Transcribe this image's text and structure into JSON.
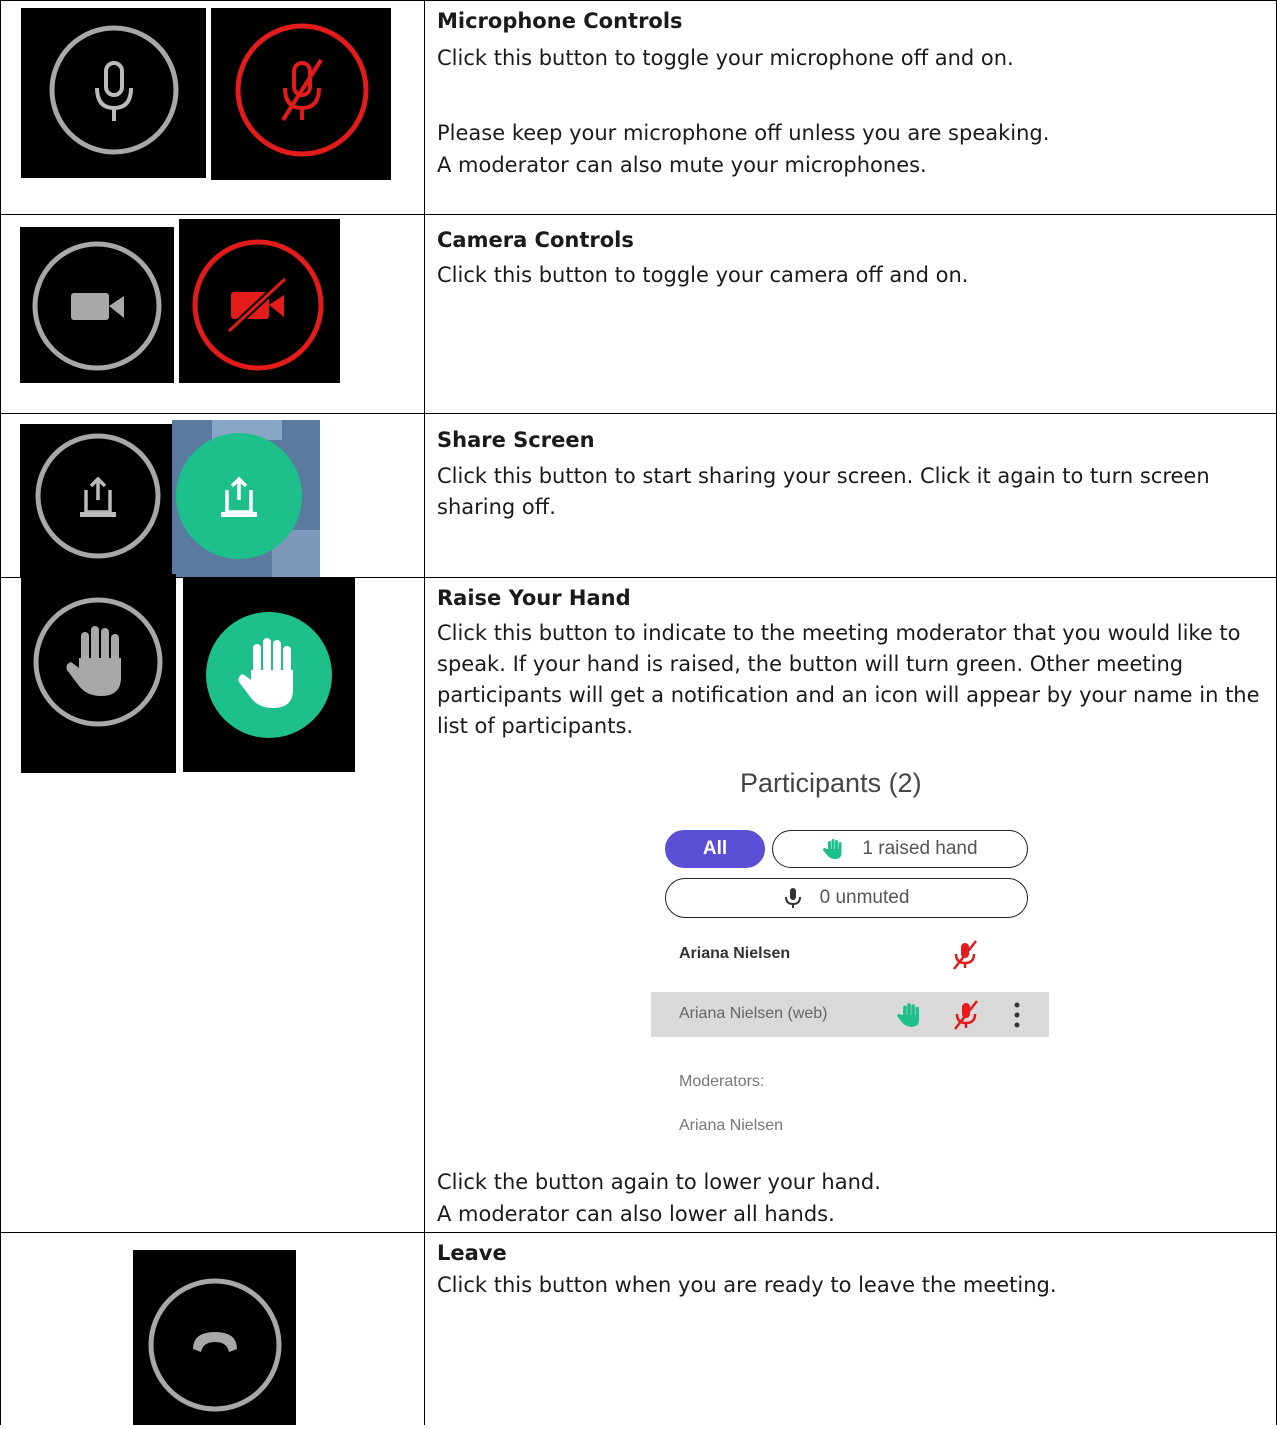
{
  "rows": [
    {
      "title": "Microphone Controls",
      "lines": [
        "Click this button to toggle your microphone off and on.",
        "Please keep your microphone off unless you are speaking.",
        "A moderator can also mute your microphones."
      ],
      "icons": [
        "microphone-icon",
        "microphone-muted-icon"
      ]
    },
    {
      "title": "Camera Controls",
      "lines": [
        "Click this button to toggle your camera off and on."
      ],
      "icons": [
        "camera-icon",
        "camera-off-icon"
      ]
    },
    {
      "title": "Share Screen",
      "lines": [
        "Click this button to start sharing your screen.  Click it again to turn screen sharing off."
      ],
      "icons": [
        "share-screen-icon",
        "share-screen-active-icon"
      ]
    },
    {
      "title": "Raise Your Hand",
      "lines": [
        "Click this button to indicate to the meeting moderator that you would like to speak.  If your hand is raised, the button will turn green.  Other meeting participants will get a notification and an icon will appear by your name in the list of participants.",
        "Click the button again to lower your hand.",
        "A moderator can also lower all hands."
      ],
      "icons": [
        "raise-hand-icon",
        "raise-hand-active-icon"
      ]
    },
    {
      "title": "Leave",
      "lines": [
        "Click this button when you are ready to leave the meeting."
      ],
      "icons": [
        "leave-call-icon"
      ]
    }
  ],
  "participants": {
    "title": "Participants (2)",
    "filter_all": "All",
    "filter_raised": "1 raised hand",
    "filter_unmuted": "0 unmuted",
    "list": [
      {
        "name": "Ariana Nielsen"
      },
      {
        "name": "Ariana Nielsen (web)"
      }
    ],
    "moderators_label": "Moderators:",
    "moderator_name": "Ariana Nielsen"
  },
  "colors": {
    "muted_red": "#e31b1b",
    "active_green": "#1dbf8a",
    "gray_icon": "#a8a8a8",
    "all_pill": "#5b4fd6"
  }
}
